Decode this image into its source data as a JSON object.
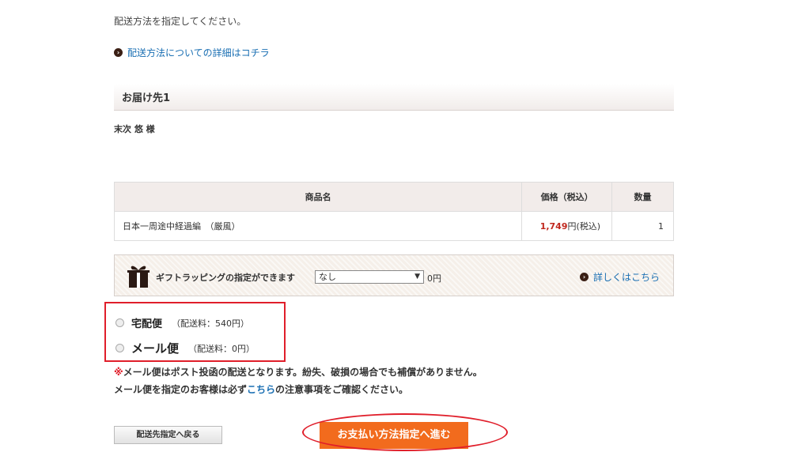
{
  "instruction": "配送方法を指定してください。",
  "detail_link": "配送方法についての詳細はコチラ",
  "section_title": "お届け先1",
  "recipient": "末次 悠 様",
  "table": {
    "headers": [
      "商品名",
      "価格（税込）",
      "数量"
    ],
    "rows": [
      {
        "name": "日本一周途中経過編　（厳風）",
        "price": "1,749",
        "price_suffix": "円(税込)",
        "qty": "1"
      }
    ]
  },
  "gift": {
    "label": "ギフトラッピングの指定ができます",
    "select_value": "なし",
    "fee": "0円",
    "more_link": "詳しくはこちら"
  },
  "shipping_options": [
    {
      "name": "宅配便",
      "fee": "（配送料：540円）"
    },
    {
      "name": "メール便",
      "fee": "（配送料：0円）"
    }
  ],
  "note1": {
    "mark": "※",
    "text": "メール便はポスト投函の配送となります。紛失、破損の場合でも補償がありません。"
  },
  "note2": {
    "before": "メール便を指定のお客様は必ず",
    "link": "こちら",
    "after": "の注意事項をご確認ください。"
  },
  "buttons": {
    "back": "配送先指定へ戻る",
    "next": "お支払い方法指定へ進む"
  },
  "colors": {
    "accent_orange": "#f26b1d",
    "highlight_red": "#e01e2a",
    "price_red": "#c0271d",
    "link_blue": "#1a6fb3"
  }
}
